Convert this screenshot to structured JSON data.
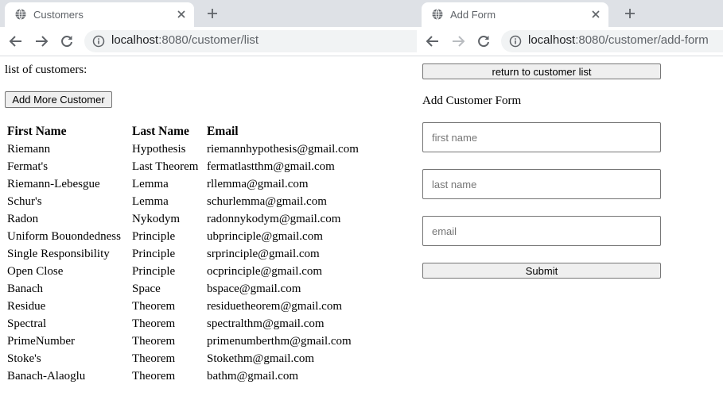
{
  "left_window": {
    "tab_title": "Customers",
    "url_host": "localhost",
    "url_rest": ":8080/customer/list",
    "content": {
      "list_label": "list of customers:",
      "add_button_label": "Add More Customer",
      "columns": [
        "First Name",
        "Last Name",
        "Email"
      ],
      "rows": [
        [
          "Riemann",
          "Hypothesis",
          "riemannhypothesis@gmail.com"
        ],
        [
          "Fermat's",
          "Last Theorem",
          "fermatlastthm@gmail.com"
        ],
        [
          "Riemann-Lebesgue",
          "Lemma",
          "rllemma@gmail.com"
        ],
        [
          "Schur's",
          "Lemma",
          "schurlemma@gmail.com"
        ],
        [
          "Radon",
          "Nykodym",
          "radonnykodym@gmail.com"
        ],
        [
          "Uniform Bouondedness",
          "Principle",
          "ubprinciple@gmail.com"
        ],
        [
          "Single Responsibility",
          "Principle",
          "srprinciple@gmail.com"
        ],
        [
          "Open Close",
          "Principle",
          "ocprinciple@gmail.com"
        ],
        [
          "Banach",
          "Space",
          "bspace@gmail.com"
        ],
        [
          "Residue",
          "Theorem",
          "residuetheorem@gmail.com"
        ],
        [
          "Spectral",
          "Theorem",
          "spectralthm@gmail.com"
        ],
        [
          "PrimeNumber",
          "Theorem",
          "primenumberthm@gmail.com"
        ],
        [
          "Stoke's",
          "Theorem",
          "Stokethm@gmail.com"
        ],
        [
          "Banach-Alaoglu",
          "Theorem",
          "bathm@gmail.com"
        ]
      ]
    }
  },
  "right_window": {
    "tab_title": "Add Form",
    "url_host": "localhost",
    "url_rest": ":8080/customer/add-form",
    "content": {
      "return_button_label": "return to customer list",
      "form_title": "Add Customer Form",
      "first_name_placeholder": "first name",
      "last_name_placeholder": "last name",
      "email_placeholder": "email",
      "submit_label": "Submit"
    }
  },
  "icons": {
    "tab_favicon": "globe-icon",
    "tab_close": "close-icon",
    "new_tab": "plus-icon",
    "back": "back-arrow-icon",
    "forward": "forward-arrow-icon",
    "reload": "reload-icon",
    "site_info": "info-icon"
  }
}
